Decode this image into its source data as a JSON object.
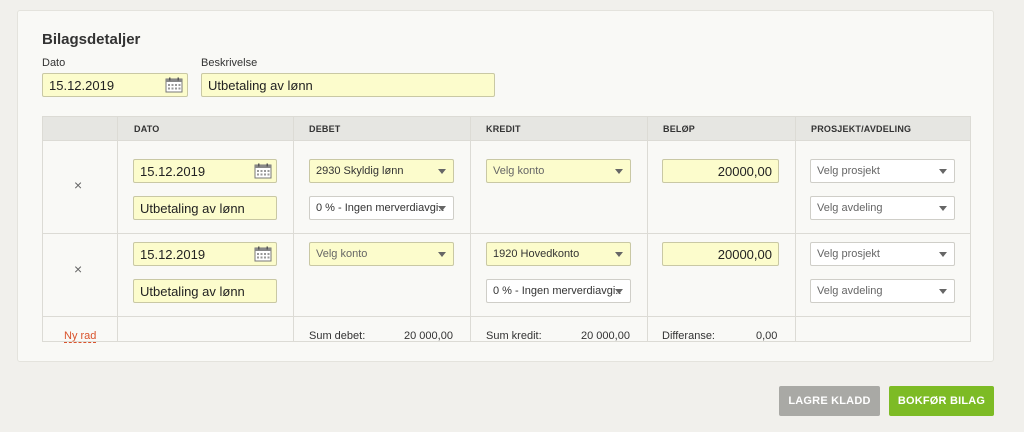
{
  "section_title": "Bilagsdetaljer",
  "header_fields": {
    "date_label": "Dato",
    "date_value": "15.12.2019",
    "description_label": "Beskrivelse",
    "description_value": "Utbetaling av lønn"
  },
  "table": {
    "columns": [
      "DATO",
      "DEBET",
      "KREDIT",
      "BELØP",
      "PROSJEKT/AVDELING"
    ],
    "rows": [
      {
        "remove": "×",
        "date": "15.12.2019",
        "description": "Utbetaling av lønn",
        "debet_account": "2930 Skyldig lønn",
        "debet_vat": "0 % - Ingen merverdiavgi..",
        "kredit_account": "Velg konto",
        "amount": "20000,00",
        "project": "Velg prosjekt",
        "department": "Velg avdeling"
      },
      {
        "remove": "×",
        "date": "15.12.2019",
        "description": "Utbetaling av lønn",
        "debet_account": "Velg konto",
        "kredit_account": "1920 Hovedkonto",
        "kredit_vat": "0 % - Ingen merverdiavgi..",
        "amount": "20000,00",
        "project": "Velg prosjekt",
        "department": "Velg avdeling"
      }
    ],
    "footer": {
      "new_row": "Ny rad",
      "sum_debet_label": "Sum debet:",
      "sum_debet_value": "20 000,00",
      "sum_kredit_label": "Sum kredit:",
      "sum_kredit_value": "20 000,00",
      "difference_label": "Differanse:",
      "difference_value": "0,00"
    }
  },
  "actions": {
    "save_draft": "LAGRE KLADD",
    "post_voucher": "BOKFØR BILAG"
  },
  "colors": {
    "field_bg": "#fcfccc",
    "link": "#d9532c",
    "save_button": "#a9a9a5",
    "post_button": "#7dbb25"
  },
  "icons": {
    "calendar": "calendar-icon",
    "remove": "close-icon",
    "dropdown": "chevron-down-icon"
  }
}
